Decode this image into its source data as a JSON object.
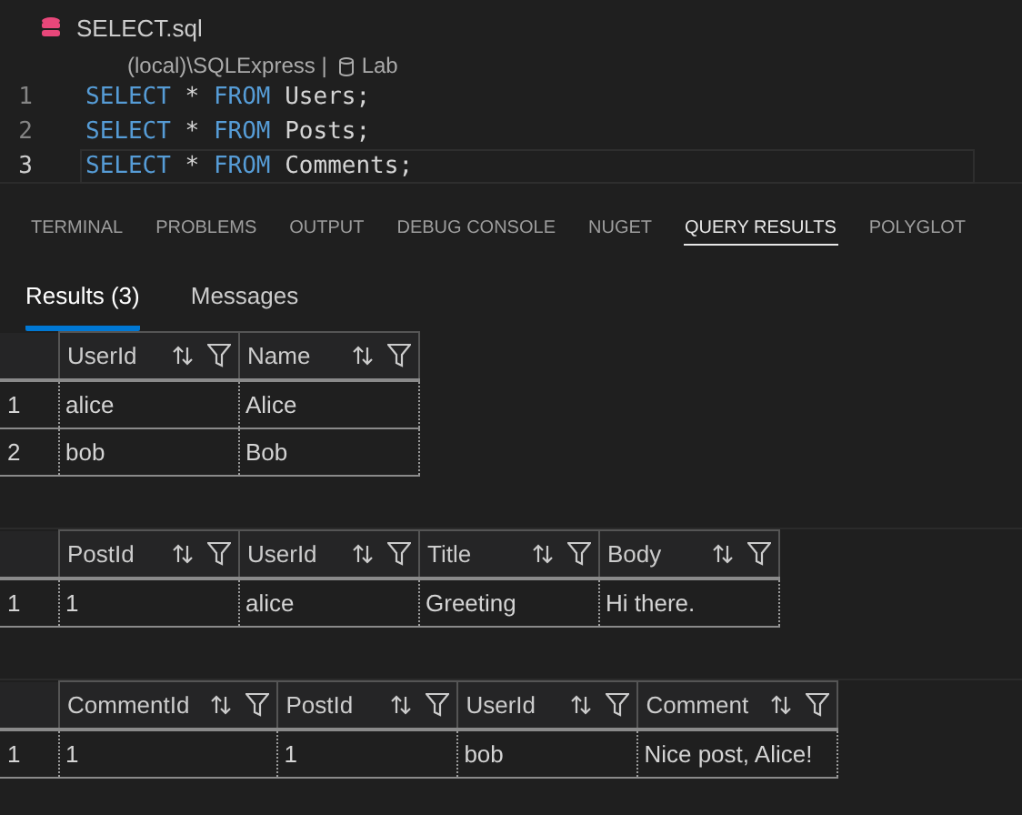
{
  "editor": {
    "file_tab": {
      "title": "SELECT.sql"
    },
    "connection": {
      "server": "(local)\\SQLExpress |",
      "database": "Lab"
    },
    "lines": [
      {
        "number": "1",
        "current": false,
        "tokens": [
          {
            "kind": "keyword",
            "text": "SELECT"
          },
          {
            "kind": "plain",
            "text": " * "
          },
          {
            "kind": "keyword",
            "text": "FROM"
          },
          {
            "kind": "plain",
            "text": " Users;"
          }
        ]
      },
      {
        "number": "2",
        "current": false,
        "tokens": [
          {
            "kind": "keyword",
            "text": "SELECT"
          },
          {
            "kind": "plain",
            "text": " * "
          },
          {
            "kind": "keyword",
            "text": "FROM"
          },
          {
            "kind": "plain",
            "text": " Posts;"
          }
        ]
      },
      {
        "number": "3",
        "current": true,
        "tokens": [
          {
            "kind": "keyword",
            "text": "SELECT"
          },
          {
            "kind": "plain",
            "text": " * "
          },
          {
            "kind": "keyword",
            "text": "FROM"
          },
          {
            "kind": "plain",
            "text": " Comments;"
          }
        ]
      }
    ]
  },
  "panel_tabs": [
    {
      "label": "TERMINAL",
      "selected": false
    },
    {
      "label": "PROBLEMS",
      "selected": false
    },
    {
      "label": "OUTPUT",
      "selected": false
    },
    {
      "label": "DEBUG CONSOLE",
      "selected": false
    },
    {
      "label": "NUGET",
      "selected": false
    },
    {
      "label": "QUERY RESULTS",
      "selected": true
    },
    {
      "label": "POLYGLOT",
      "selected": false
    }
  ],
  "result_tabs": [
    {
      "label": "Results (3)",
      "selected": true
    },
    {
      "label": "Messages",
      "selected": false
    }
  ],
  "result_sets": [
    {
      "columns": [
        "UserId",
        "Name"
      ],
      "rows": [
        {
          "number": "1",
          "cells": [
            "alice",
            "Alice"
          ]
        },
        {
          "number": "2",
          "cells": [
            "bob",
            "Bob"
          ]
        }
      ]
    },
    {
      "columns": [
        "PostId",
        "UserId",
        "Title",
        "Body"
      ],
      "rows": [
        {
          "number": "1",
          "cells": [
            "1",
            "alice",
            "Greeting",
            "Hi there."
          ]
        }
      ]
    },
    {
      "columns": [
        "CommentId",
        "PostId",
        "UserId",
        "Comment"
      ],
      "rows": [
        {
          "number": "1",
          "cells": [
            "1",
            "1",
            "bob",
            "Nice post, Alice!"
          ]
        }
      ]
    }
  ]
}
